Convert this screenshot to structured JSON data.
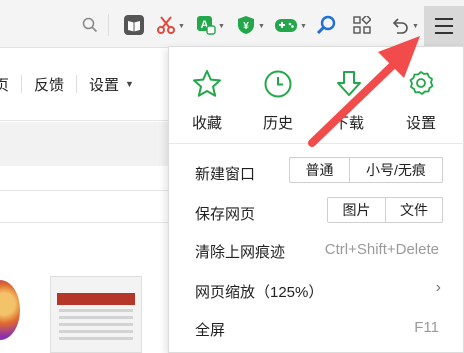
{
  "toolbar": {
    "icons": [
      "search-icon",
      "reader-icon",
      "screenshot-icon",
      "translate-icon",
      "shield-icon",
      "game-icon",
      "magnifier-icon",
      "apps-icon",
      "undo-icon",
      "menu-icon"
    ],
    "accent_green": "#22a84a"
  },
  "background_page": {
    "nav": [
      "页",
      "反馈",
      "设置"
    ]
  },
  "menu": {
    "quick_actions": [
      {
        "label": "收藏",
        "icon": "star-icon"
      },
      {
        "label": "历史",
        "icon": "clock-icon"
      },
      {
        "label": "下载",
        "icon": "download-icon"
      },
      {
        "label": "设置",
        "icon": "gear-icon"
      }
    ],
    "new_window": {
      "label": "新建窗口",
      "options": [
        "普通",
        "小号/无痕"
      ]
    },
    "save_page": {
      "label": "保存网页",
      "options": [
        "图片",
        "文件"
      ]
    },
    "clear_traces": {
      "label": "清除上网痕迹",
      "shortcut": "Ctrl+Shift+Delete"
    },
    "zoom": {
      "label": "网页缩放（125%）"
    },
    "fullscreen": {
      "label": "全屏",
      "shortcut": "F11"
    }
  },
  "annotation": {
    "arrow_color": "#f24b4b"
  }
}
